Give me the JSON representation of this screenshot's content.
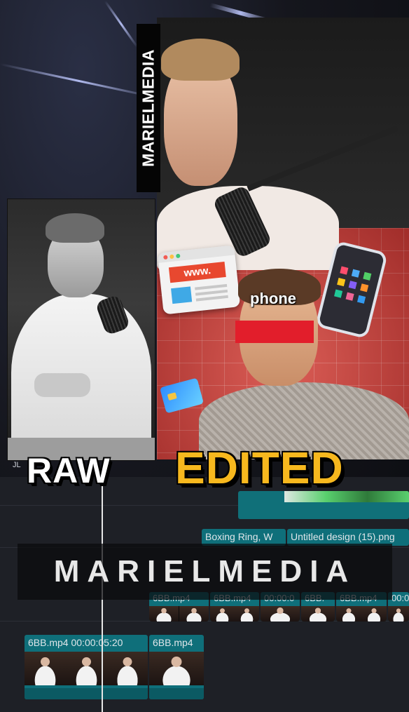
{
  "watermarks": {
    "vertical": "MARIELMEDIA",
    "banner": "MARIELMEDIA"
  },
  "labels": {
    "raw": "RAW",
    "edited": "EDITED"
  },
  "edited_overlay": {
    "phone_caption": "phone",
    "browser_text": "www."
  },
  "timeline": {
    "clips": [
      {
        "name": "Boxing Ring, W"
      },
      {
        "name": "Untitled design (15).png"
      },
      {
        "name": "6BB.mp4"
      },
      {
        "name": "6BB.mp4"
      },
      {
        "name": "00:00:0"
      },
      {
        "name": "6BB."
      },
      {
        "name": "6BB.mp4"
      },
      {
        "name": "00:0"
      },
      {
        "name": "6BB.mp4  00:00:05:20"
      },
      {
        "name": "6BB.mp4"
      }
    ],
    "left_marker": "JL"
  },
  "colors": {
    "edited_label": "#f7b81e",
    "raw_label": "#ffffff",
    "grid_red": "#c9453f",
    "clip_teal": "#0f6f7a"
  }
}
